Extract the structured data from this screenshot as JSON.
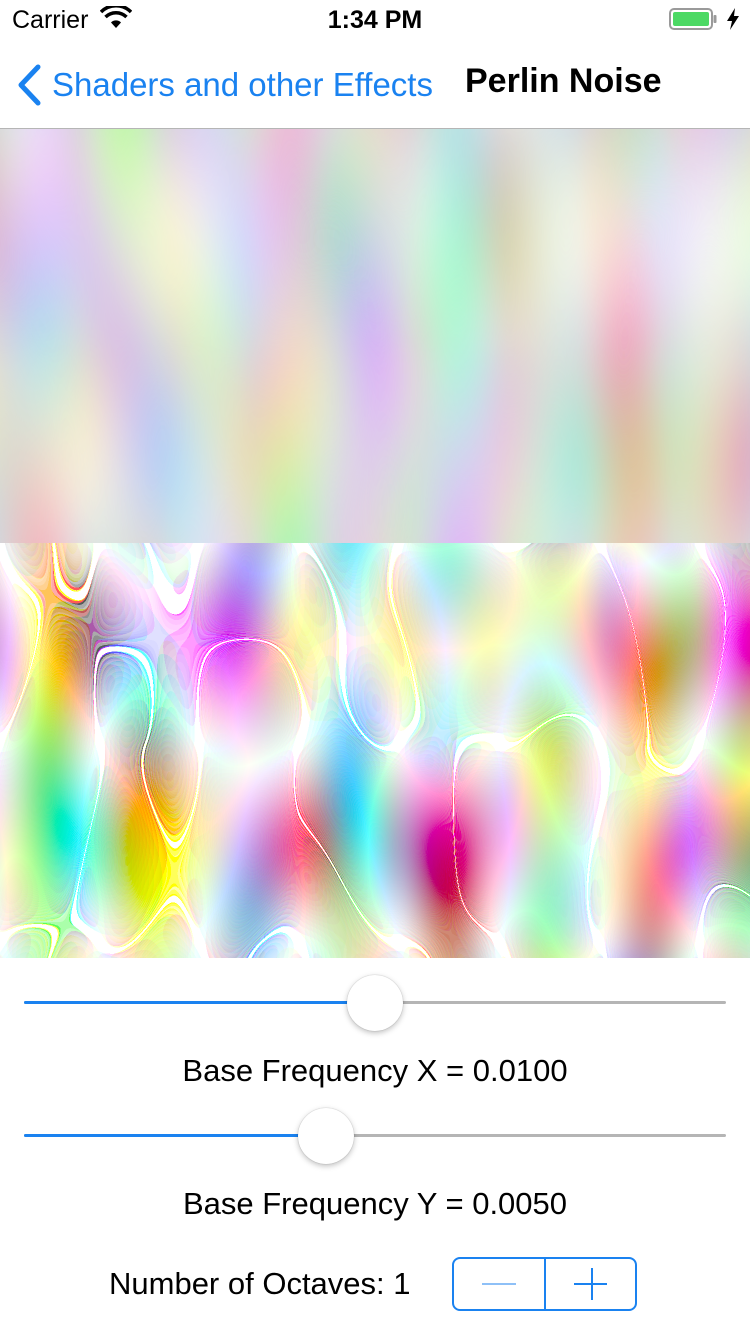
{
  "status_bar": {
    "carrier": "Carrier",
    "time": "1:34 PM",
    "battery_color": "#4cd964"
  },
  "nav": {
    "back_label": "Shaders and other Effects",
    "title": "Perlin Noise",
    "accent_color": "#1a82f0"
  },
  "controls": {
    "base_frequency_x": {
      "label": "Base Frequency X = 0.0100",
      "fraction": 0.5
    },
    "base_frequency_y": {
      "label": "Base Frequency Y = 0.0050",
      "fraction": 0.43
    },
    "octaves": {
      "label": "Number of Octaves: 1",
      "minus_icon": "minus-icon",
      "plus_icon": "plus-icon"
    }
  }
}
